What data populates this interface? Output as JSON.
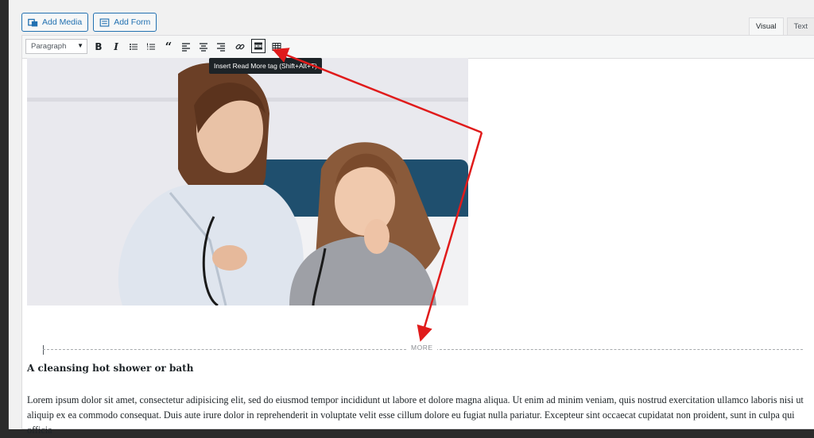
{
  "media": {
    "add_media": "Add Media",
    "add_form": "Add Form"
  },
  "tabs": {
    "visual": "Visual",
    "text": "Text"
  },
  "toolbar": {
    "format_value": "Paragraph",
    "tooltip": "Insert Read More tag (Shift+Alt+T)"
  },
  "icons": [
    "bold-icon",
    "italic-icon",
    "bullet-list-icon",
    "numbered-list-icon",
    "blockquote-icon",
    "align-left-icon",
    "align-center-icon",
    "align-right-icon",
    "link-icon",
    "read-more-icon",
    "toolbar-toggle-icon"
  ],
  "content": {
    "more_label": "MORE",
    "heading": "A cleansing hot shower or bath",
    "paragraph": "Lorem ipsum dolor sit amet, consectetur adipisicing elit, sed do eiusmod tempor incididunt ut labore et dolore magna aliqua. Ut enim ad minim veniam, quis nostrud exercitation ullamco laboris nisi ut aliquip ex ea commodo consequat. Duis aute irure dolor in reprehenderit in voluptate velit esse cillum dolore eu fugiat nulla pariatur. Excepteur sint occaecat cupidatat non proident, sunt in culpa qui officia"
  },
  "colors": {
    "accent": "#2271b1",
    "arrow": "#e01b1b"
  }
}
